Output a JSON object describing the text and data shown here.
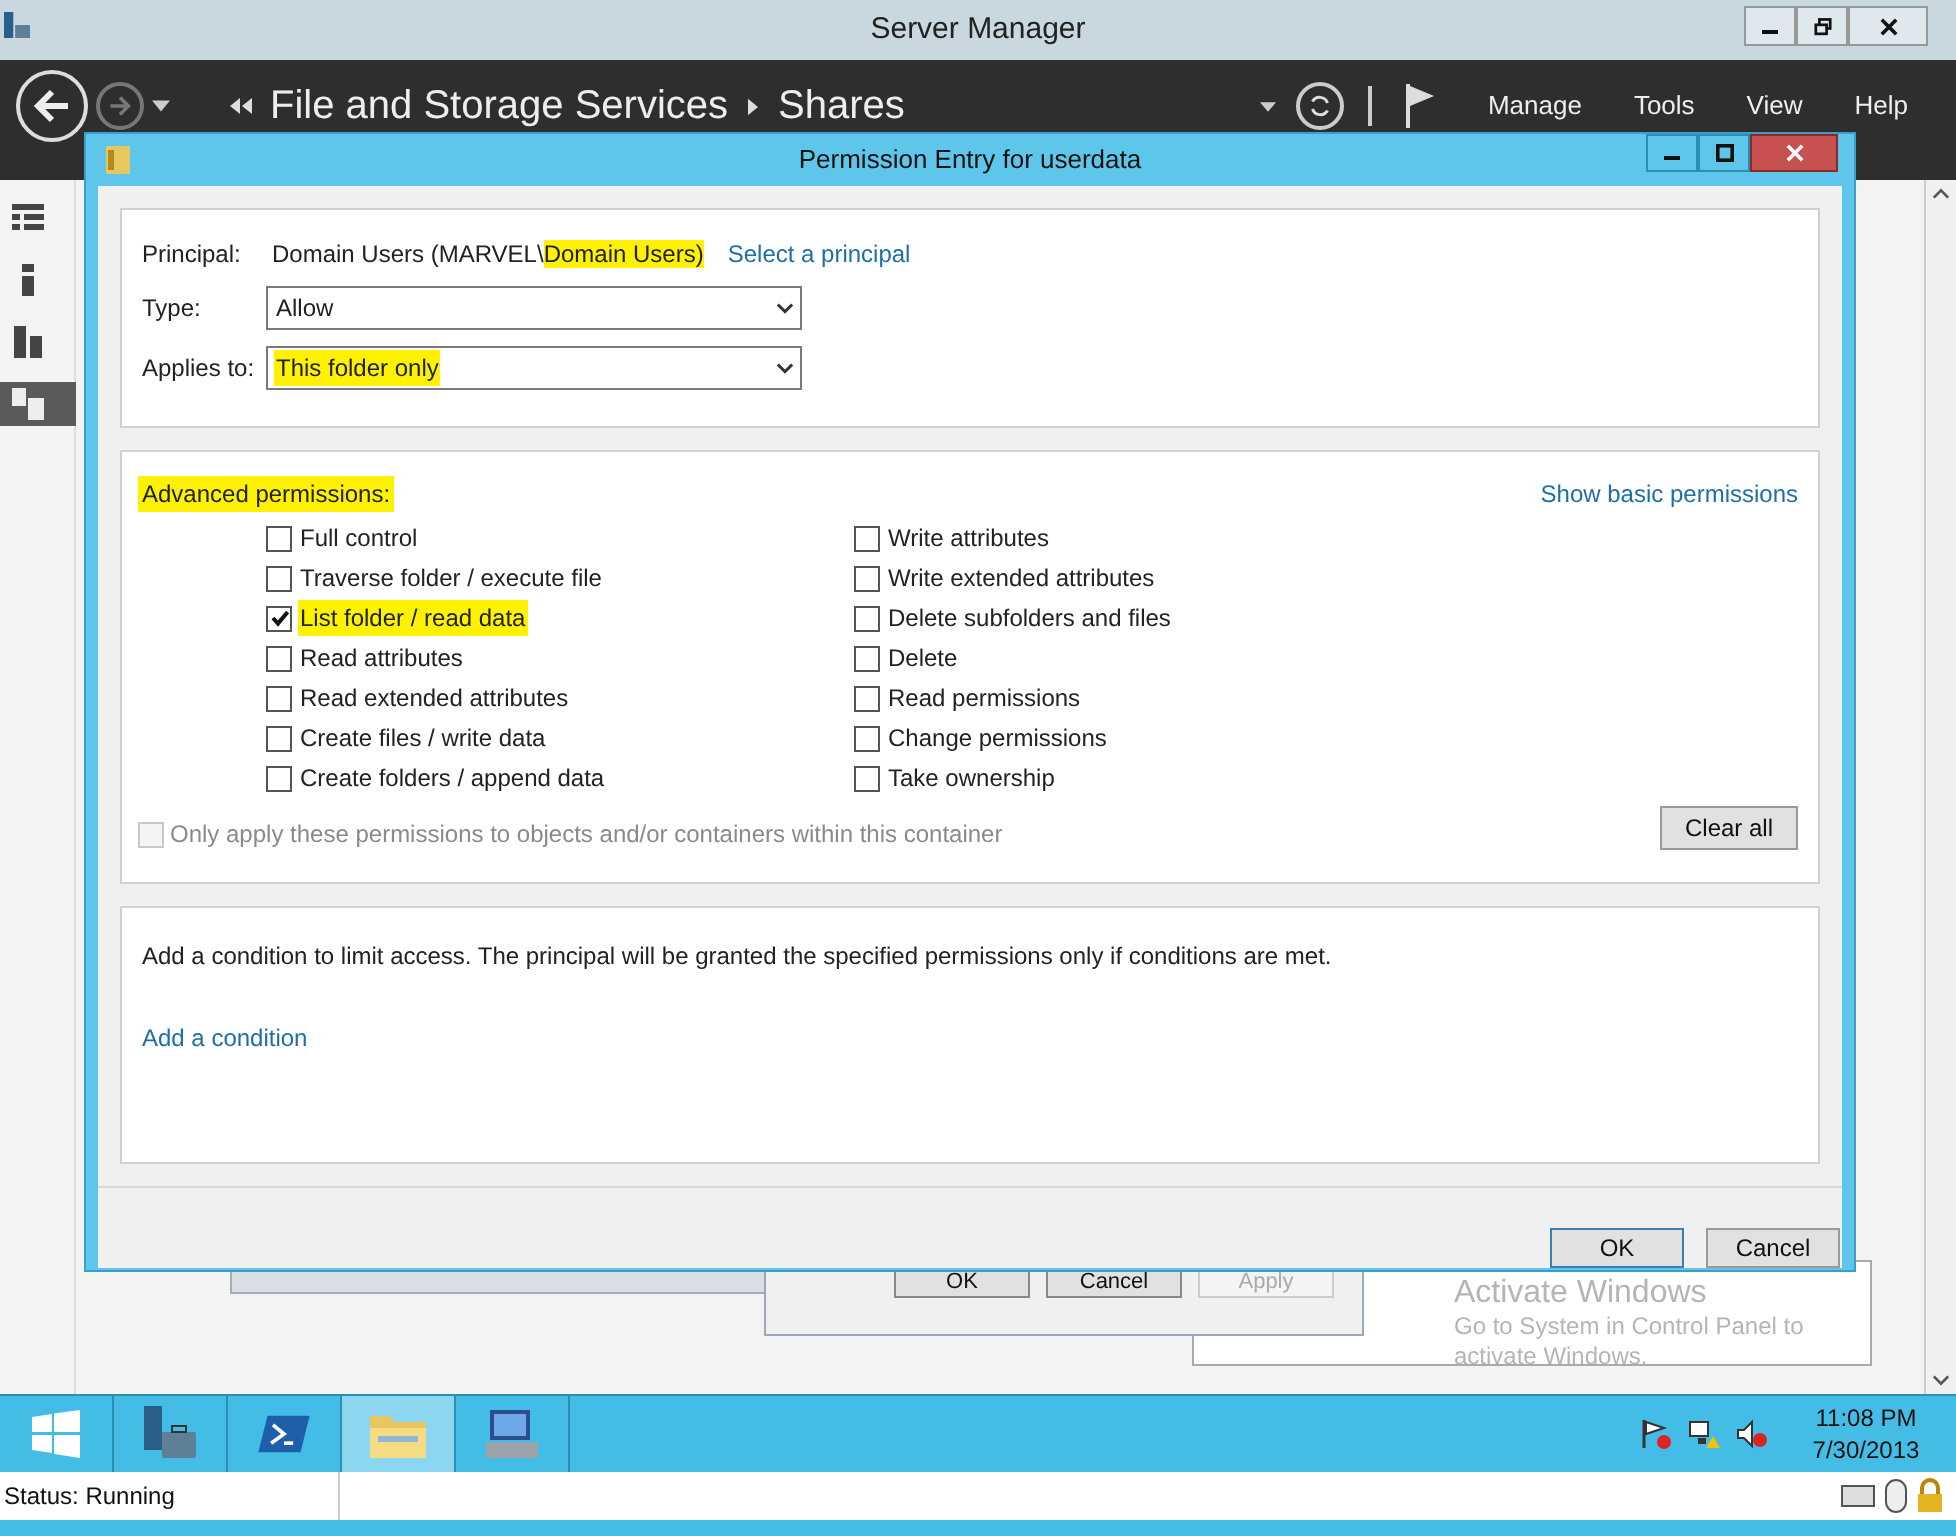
{
  "window": {
    "title": "Server Manager"
  },
  "header": {
    "breadcrumb": [
      "File and Storage Services",
      "Shares"
    ],
    "menu": [
      "Manage",
      "Tools",
      "View",
      "Help"
    ]
  },
  "sidebar": {
    "items": [
      {
        "kind": "dashboard",
        "selected": false
      },
      {
        "kind": "server",
        "selected": false
      },
      {
        "kind": "servers",
        "selected": false
      },
      {
        "kind": "storage",
        "selected": true
      }
    ]
  },
  "dialog": {
    "title": "Permission Entry for userdata",
    "principal": {
      "label": "Principal:",
      "value": "Domain Users (MARVEL\\",
      "value_highlighted": "Domain Users)",
      "link": "Select a principal"
    },
    "type": {
      "label": "Type:",
      "value": "Allow",
      "highlighted": false
    },
    "applies_to": {
      "label": "Applies to:",
      "value": "This folder only",
      "highlighted": true
    },
    "permissions": {
      "heading": "Advanced permissions:",
      "heading_highlighted": true,
      "toggle_link": "Show basic permissions",
      "left": [
        {
          "label": "Full control",
          "checked": false,
          "highlighted": false
        },
        {
          "label": "Traverse folder / execute file",
          "checked": false,
          "highlighted": false
        },
        {
          "label": "List folder / read data",
          "checked": true,
          "highlighted": true
        },
        {
          "label": "Read attributes",
          "checked": false,
          "highlighted": false
        },
        {
          "label": "Read extended attributes",
          "checked": false,
          "highlighted": false
        },
        {
          "label": "Create files / write data",
          "checked": false,
          "highlighted": false
        },
        {
          "label": "Create folders / append data",
          "checked": false,
          "highlighted": false
        }
      ],
      "right": [
        {
          "label": "Write attributes",
          "checked": false,
          "highlighted": false
        },
        {
          "label": "Write extended attributes",
          "checked": false,
          "highlighted": false
        },
        {
          "label": "Delete subfolders and files",
          "checked": false,
          "highlighted": false
        },
        {
          "label": "Delete",
          "checked": false,
          "highlighted": false
        },
        {
          "label": "Read permissions",
          "checked": false,
          "highlighted": false
        },
        {
          "label": "Change permissions",
          "checked": false,
          "highlighted": false
        },
        {
          "label": "Take ownership",
          "checked": false,
          "highlighted": false
        }
      ],
      "inherit_option": {
        "label": "Only apply these permissions to objects and/or containers within this container",
        "checked": false,
        "disabled": true
      },
      "clear_button": "Clear all"
    },
    "condition": {
      "text": "Add a condition to limit access. The principal will be granted the specified permissions only if conditions are met.",
      "link": "Add a condition"
    },
    "buttons": [
      "OK",
      "Cancel"
    ]
  },
  "background_dialog": {
    "buttons": [
      {
        "label": "OK",
        "disabled": false
      },
      {
        "label": "Cancel",
        "disabled": false
      },
      {
        "label": "Apply",
        "disabled": true
      }
    ]
  },
  "activation_notice": {
    "title": "Activate Windows",
    "text": "Go to System in Control Panel to",
    "text_2": "activate Windows."
  },
  "taskbar": {
    "apps": [
      {
        "kind": "start",
        "selected": false
      },
      {
        "kind": "server-manager",
        "selected": false
      },
      {
        "kind": "powershell",
        "selected": false
      },
      {
        "kind": "explorer",
        "selected": true
      },
      {
        "kind": "computer",
        "selected": false
      }
    ],
    "clock": {
      "time": "11:08 PM",
      "date": "7/30/2013"
    }
  },
  "status_bar": {
    "text": "Status: Running"
  }
}
